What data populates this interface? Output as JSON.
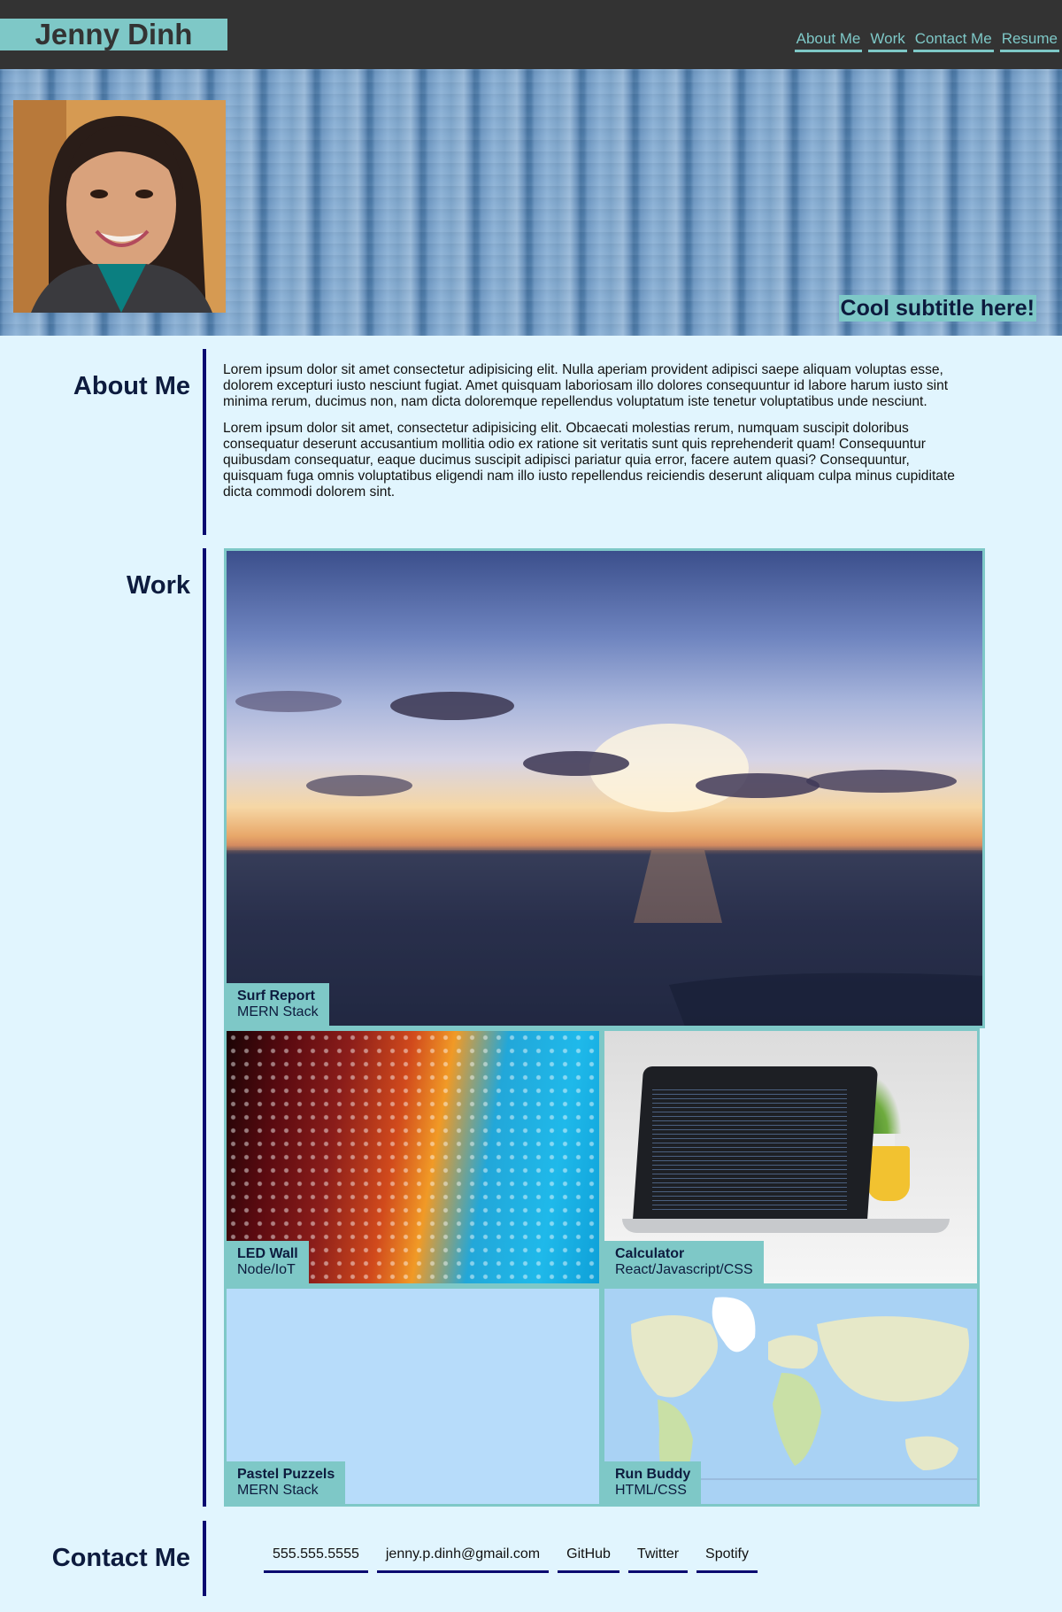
{
  "header": {
    "brand": "Jenny Dinh",
    "nav": [
      "About Me",
      "Work",
      "Contact Me",
      "Resume"
    ]
  },
  "hero": {
    "subtitle": "Cool subtitle here!"
  },
  "about": {
    "title": "About Me",
    "paragraphs": [
      "Lorem ipsum dolor sit amet consectetur adipisicing elit. Nulla aperiam provident adipisci saepe aliquam voluptas esse, dolorem excepturi iusto nesciunt fugiat. Amet quisquam laboriosam illo dolores consequuntur id labore harum iusto sint minima rerum, ducimus non, nam dicta doloremque repellendus voluptatum iste tenetur voluptatibus unde nesciunt.",
      "Lorem ipsum dolor sit amet, consectetur adipisicing elit. Obcaecati molestias rerum, numquam suscipit doloribus consequatur deserunt accusantium mollitia odio ex ratione sit veritatis sunt quis reprehenderit quam! Consequuntur quibusdam consequatur, eaque ducimus suscipit adipisci pariatur quia error, facere autem quasi? Consequuntur, quisquam fuga omnis voluptatibus eligendi nam illo iusto repellendus reiciendis deserunt aliquam culpa minus cupiditate dicta commodi dolorem sint."
    ]
  },
  "work": {
    "title": "Work",
    "projects": [
      {
        "name": "Surf Report",
        "stack": "MERN Stack"
      },
      {
        "name": "LED Wall",
        "stack": "Node/IoT"
      },
      {
        "name": "Calculator",
        "stack": "React/Javascript/CSS"
      },
      {
        "name": "Pastel Puzzels",
        "stack": "MERN Stack"
      },
      {
        "name": "Run Buddy",
        "stack": "HTML/CSS"
      }
    ]
  },
  "contact": {
    "title": "Contact Me",
    "links": [
      "555.555.5555",
      "jenny.p.dinh@gmail.com",
      "GitHub",
      "Twitter",
      "Spotify"
    ]
  },
  "colors": {
    "accent": "#7ec8c7",
    "header_bg": "#333333",
    "page_bg": "#e1f5fe",
    "divider": "#0a0a70",
    "heading": "#0d1b3e"
  }
}
